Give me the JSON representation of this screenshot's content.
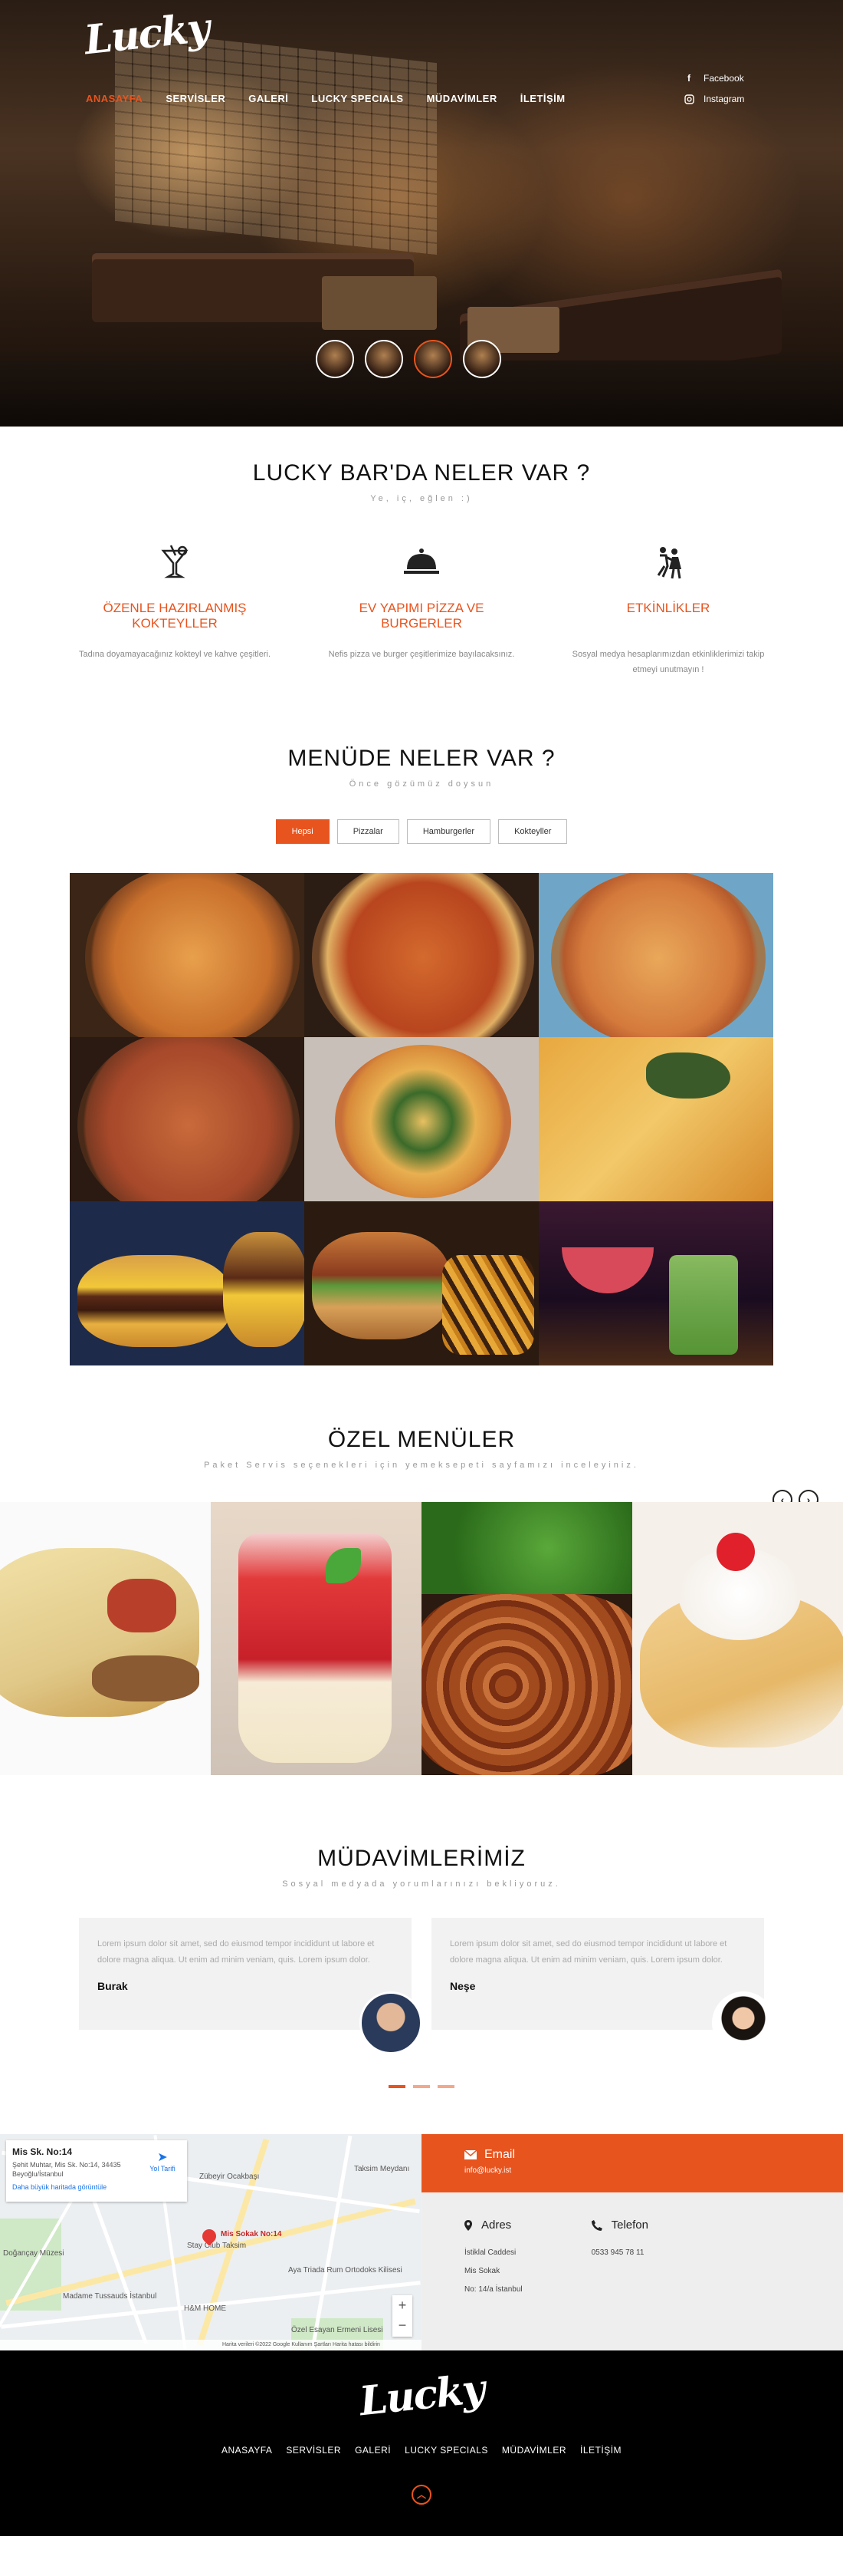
{
  "brand": {
    "logo": "Lucky",
    "accent": "#e8541e"
  },
  "nav": [
    "ANASAYFA",
    "SERVİSLER",
    "GALERİ",
    "LUCKY SPECIALS",
    "MÜDAVİMLER",
    "İLETİŞİM"
  ],
  "social": {
    "facebook": "Facebook",
    "instagram": "Instagram",
    "facebook_icon": "facebook-icon",
    "instagram_icon": "instagram-icon"
  },
  "features": {
    "title": "LUCKY BAR'DA NELER VAR ?",
    "subtitle": "Ye, iç, eğlen :)",
    "items": [
      {
        "icon": "cocktail-icon",
        "title": "ÖZENLE HAZIRLANMIŞ KOKTEYLLER",
        "text": "Tadına doyamayacağınız kokteyl ve kahve çeşitleri."
      },
      {
        "icon": "cloche-icon",
        "title": "EV YAPIMI PİZZA VE BURGERLER",
        "text": "Nefis pizza ve burger çeşitlerimize bayılacaksınız."
      },
      {
        "icon": "dancing-icon",
        "title": "ETKİNLİKLER",
        "text": "Sosyal medya hesaplarımızdan etkinliklerimizi takip etmeyi unutmayın !"
      }
    ]
  },
  "menu": {
    "title": "MENÜDE NELER VAR ?",
    "subtitle": "Önce gözümüz doysun",
    "filters": [
      "Hepsi",
      "Pizzalar",
      "Hamburgerler",
      "Kokteyller"
    ],
    "active_filter": "Hepsi"
  },
  "ozel": {
    "title": "ÖZEL MENÜLER",
    "subtitle": "Paket Servis seçenekleri için yemeksepeti sayfamızı inceleyiniz.",
    "prev_icon": "chevron-left-icon",
    "next_icon": "chevron-right-icon"
  },
  "regulars": {
    "title": "MÜDAVİMLERİMİZ",
    "subtitle": "Sosyal medyada yorumlarınızı bekliyoruz.",
    "testimonials": [
      {
        "text": "Lorem ipsum dolor sit amet, sed do eiusmod tempor incididunt ut labore et dolore magna aliqua. Ut enim ad minim veniam, quis. Lorem ipsum dolor.",
        "name": "Burak"
      },
      {
        "text": "Lorem ipsum dolor sit amet, sed do eiusmod tempor incididunt ut labore et dolore magna aliqua. Ut enim ad minim veniam, quis. Lorem ipsum dolor.",
        "name": "Neşe"
      }
    ]
  },
  "map": {
    "card_title": "Mis Sk. No:14",
    "card_address": "Şehit Muhtar, Mis Sk. No:14, 34435 Beyoğlu/İstanbul",
    "card_link": "Daha büyük haritada görüntüle",
    "directions": "Yol Tarifi",
    "pin_label": "Mis Sokak No:14",
    "labels": [
      "Taksim Meydanı",
      "Doğançay Müzesi",
      "Stay Club Taksim",
      "Aya Triada Rum Ortodoks Kilisesi",
      "Madame Tussauds İstanbul",
      "H&M HOME",
      "Özel Esayan Ermeni Lisesi",
      "Zübeyir Ocakbaşı"
    ],
    "footer": "Harita verileri ©2022 Google   Kullanım Şartları   Harita hatası bildirin"
  },
  "contact": {
    "email_label": "Email",
    "email": "info@lucky.ist",
    "address_label": "Adres",
    "address_lines": [
      "İstiklal Caddesi",
      "Mis Sokak",
      "No: 14/a İstanbul"
    ],
    "phone_label": "Telefon",
    "phone": "0533 945 78 11"
  },
  "footer": {
    "logo": "Lucky",
    "nav": [
      "ANASAYFA",
      "SERVİSLER",
      "GALERİ",
      "LUCKY SPECIALS",
      "MÜDAVİMLER",
      "İLETİŞİM"
    ],
    "top_icon": "chevron-up-icon"
  }
}
